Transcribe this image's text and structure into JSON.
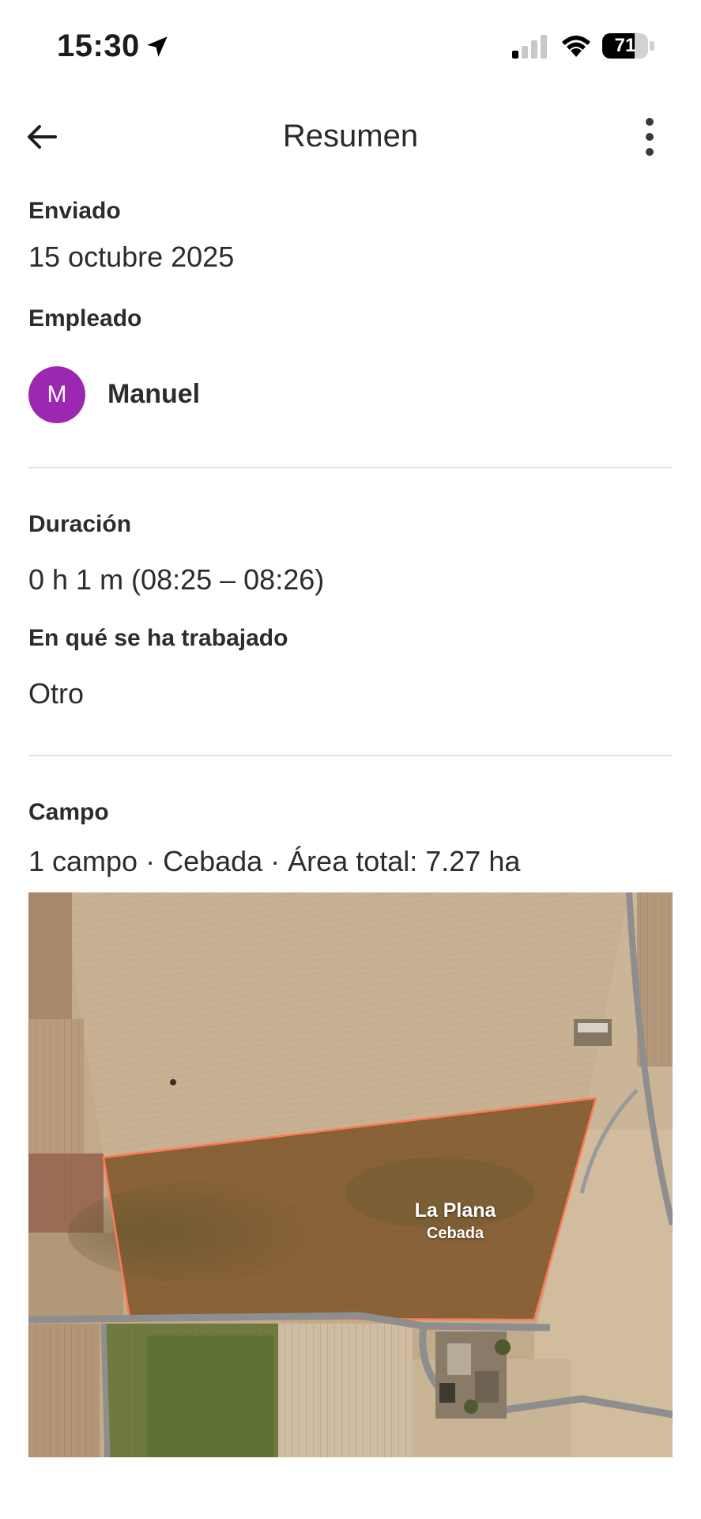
{
  "status_bar": {
    "time": "15:30",
    "battery_percent": 71,
    "battery_label": "71",
    "signal_bars_active": 1,
    "signal_bars_total": 4
  },
  "app_bar": {
    "title": "Resumen",
    "back_icon": "arrow-left-icon",
    "menu_icon": "more-vertical-icon"
  },
  "sent": {
    "label": "Enviado",
    "value": "15 octubre 2025"
  },
  "employee": {
    "label": "Empleado",
    "avatar_initial": "M",
    "avatar_color": "#9c27b0",
    "name": "Manuel"
  },
  "duration": {
    "label": "Duración",
    "value": "0 h 1 m (08:25 – 08:26)"
  },
  "work": {
    "label": "En qué se ha trabajado",
    "value": "Otro"
  },
  "field": {
    "label": "Campo",
    "summary": "1 campo · Cebada · Área total: 7.27 ha",
    "map": {
      "field_name": "La Plana",
      "crop": "Cebada",
      "outline_color": "#ff7a55"
    }
  }
}
